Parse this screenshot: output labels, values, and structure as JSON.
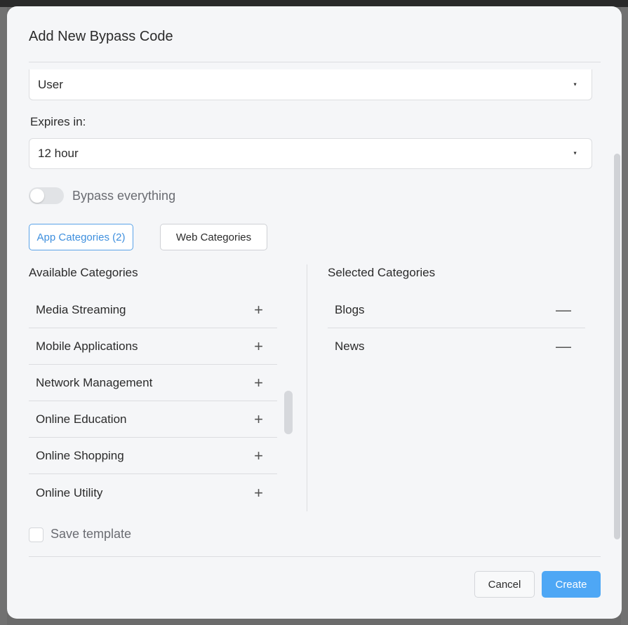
{
  "modal": {
    "title": "Add New Bypass Code"
  },
  "scope_select": {
    "value": "User",
    "caret_icon": "caret-down-icon"
  },
  "expiry": {
    "label": "Expires in:",
    "value": "12 hour",
    "caret_icon": "caret-down-icon"
  },
  "bypass_toggle": {
    "label": "Bypass everything",
    "on": false
  },
  "tabs": [
    {
      "label": "App Categories (2)",
      "active": true
    },
    {
      "label": "Web Categories",
      "active": false
    }
  ],
  "available": {
    "heading": "Available Categories",
    "items": [
      {
        "label": "Media Streaming",
        "icon": "plus-icon"
      },
      {
        "label": "Mobile Applications",
        "icon": "plus-icon"
      },
      {
        "label": "Network Management",
        "icon": "plus-icon"
      },
      {
        "label": "Online Education",
        "icon": "plus-icon"
      },
      {
        "label": "Online Shopping",
        "icon": "plus-icon"
      },
      {
        "label": "Online Utility",
        "icon": "plus-icon"
      }
    ]
  },
  "selected": {
    "heading": "Selected Categories",
    "items": [
      {
        "label": "Blogs",
        "icon": "minus-icon"
      },
      {
        "label": "News",
        "icon": "minus-icon"
      }
    ]
  },
  "save_template": {
    "label": "Save template",
    "checked": false
  },
  "footer": {
    "cancel_label": "Cancel",
    "create_label": "Create"
  },
  "colors": {
    "accent": "#4ea7f5",
    "tab_active": "#3e8fde"
  }
}
